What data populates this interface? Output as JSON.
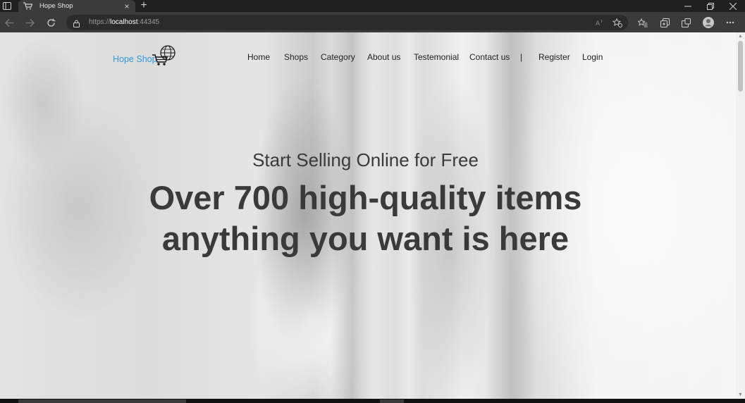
{
  "browser": {
    "tab_title": "Hope Shop",
    "new_tab_label": "+",
    "tab_close_label": "×",
    "url_scheme": "https://",
    "url_host": "localhost",
    "url_port": ":44345",
    "icons": [
      "sidebar-toggle-icon",
      "tab-favicon-icon",
      "back-icon",
      "forward-icon",
      "refresh-icon",
      "lock-icon",
      "read-aloud-icon",
      "favorite-add-icon",
      "favorites-icon",
      "collections-icon",
      "extensions-icon",
      "profile-icon",
      "more-icon",
      "minimize-icon",
      "restore-icon",
      "close-window-icon"
    ]
  },
  "site": {
    "brand": "Hope Shop",
    "brand_color": "#2f98d9",
    "nav": {
      "home": "Home",
      "shops": "Shops",
      "category": "Category",
      "about": "About us",
      "testimonial": "Testemonial",
      "contact": "Contact us",
      "separator": "|",
      "register": "Register",
      "login": "Login"
    }
  },
  "hero": {
    "subtitle": "Start Selling Online for Free",
    "title_line1": "Over 700 high-quality items",
    "title_line2": "anything you want is here"
  }
}
